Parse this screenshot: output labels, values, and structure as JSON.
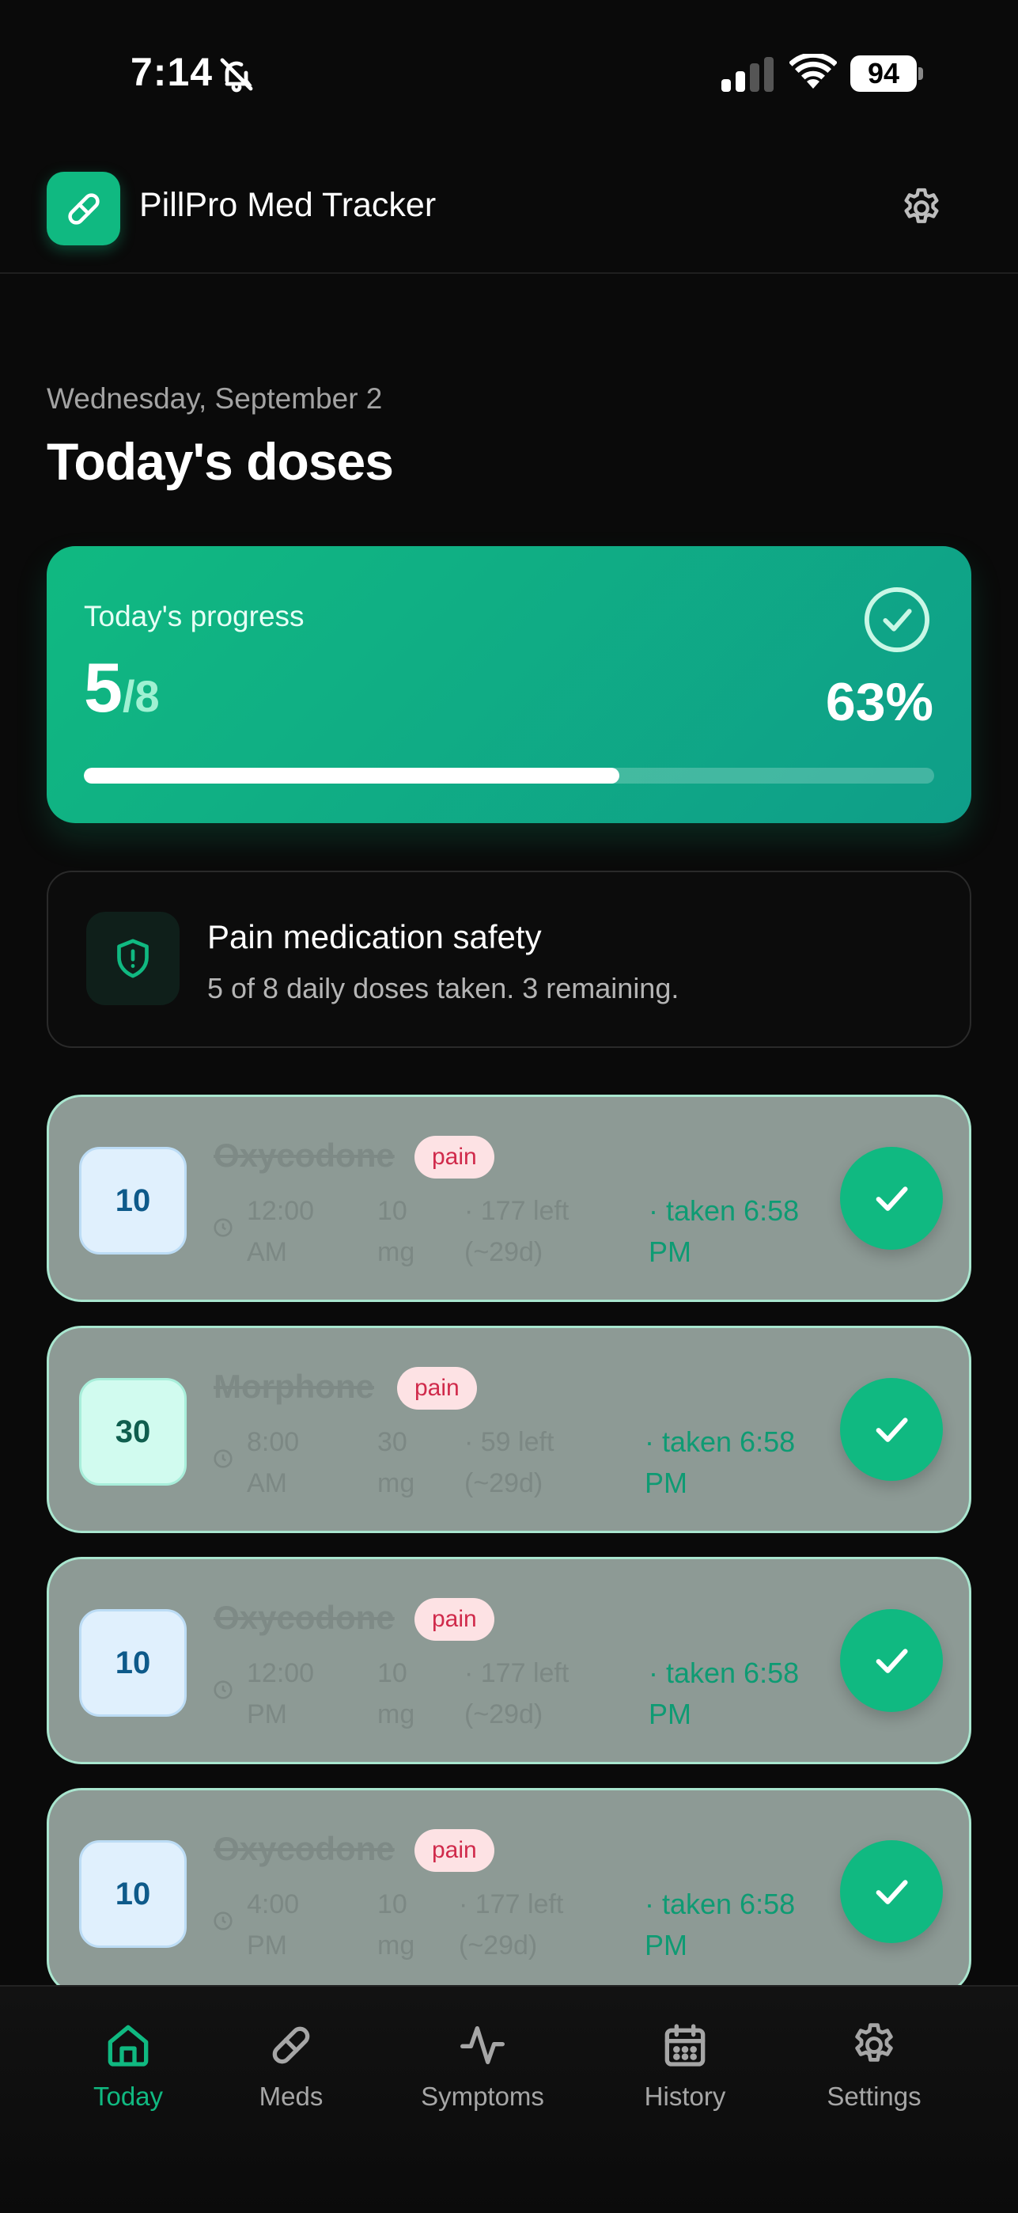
{
  "status_bar": {
    "time": "7:14",
    "battery": "94"
  },
  "header": {
    "app_title": "PillPro Med Tracker"
  },
  "date": "Wednesday, September 2",
  "page_title": "Today's doses",
  "progress": {
    "label": "Today's progress",
    "taken": "5",
    "total": "/8",
    "percent_text": "63%",
    "fraction": 0.63
  },
  "safety": {
    "title": "Pain medication safety",
    "subtitle": "5 of 8 daily doses taken. 3 remaining."
  },
  "doses": [
    {
      "badge": "10",
      "name": "Oxycodone",
      "tag": "pain",
      "time": "12:00 AM",
      "mg": "10 mg",
      "left": "· 177 left (~29d)",
      "taken": "· taken 6:58 PM"
    },
    {
      "badge": "30",
      "name": "Morphone",
      "tag": "pain",
      "time": "8:00 AM",
      "mg": "30 mg",
      "left": "· 59 left (~29d)",
      "taken": "· taken 6:58 PM"
    },
    {
      "badge": "10",
      "name": "Oxycodone",
      "tag": "pain",
      "time": "12:00 PM",
      "mg": "10 mg",
      "left": "· 177 left (~29d)",
      "taken": "· taken 6:58 PM"
    },
    {
      "badge": "10",
      "name": "Oxycodone",
      "tag": "pain",
      "time": "4:00 PM",
      "mg": "10 mg",
      "left": "· 177 left (~29d)",
      "taken": "· taken 6:58 PM"
    }
  ],
  "nav": [
    {
      "label": "Today",
      "icon": "home-icon",
      "active": true
    },
    {
      "label": "Meds",
      "icon": "pill-icon",
      "active": false
    },
    {
      "label": "Symptoms",
      "icon": "activity-icon",
      "active": false
    },
    {
      "label": "History",
      "icon": "calendar-icon",
      "active": false
    },
    {
      "label": "Settings",
      "icon": "gear-icon",
      "active": false
    }
  ],
  "colors": {
    "accent": "#10b981",
    "card_taken": "#8d9a95",
    "tag_text": "#d02a4b"
  }
}
